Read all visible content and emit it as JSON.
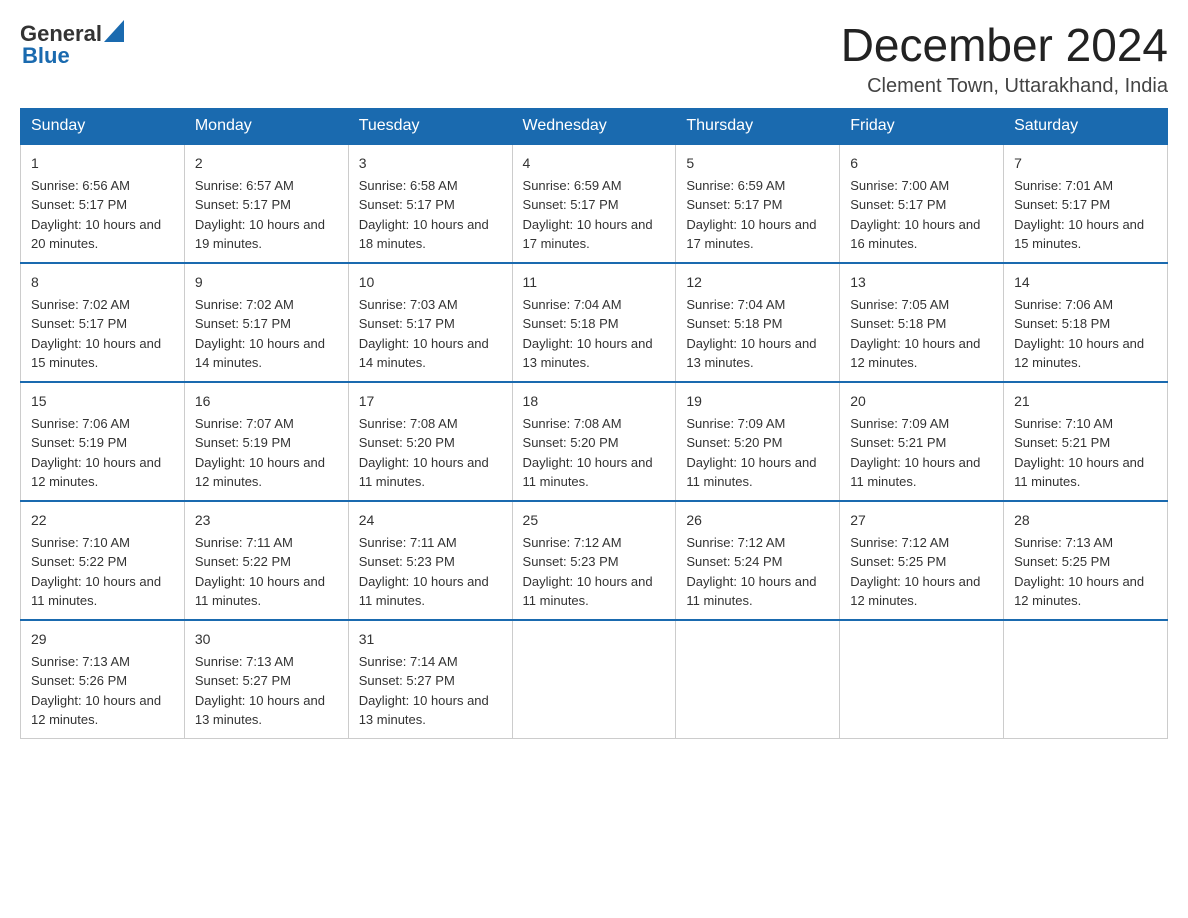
{
  "header": {
    "logo_general": "General",
    "logo_blue": "Blue",
    "title": "December 2024",
    "subtitle": "Clement Town, Uttarakhand, India"
  },
  "days_of_week": [
    "Sunday",
    "Monday",
    "Tuesday",
    "Wednesday",
    "Thursday",
    "Friday",
    "Saturday"
  ],
  "weeks": [
    [
      {
        "day": "1",
        "sunrise": "6:56 AM",
        "sunset": "5:17 PM",
        "daylight": "10 hours and 20 minutes."
      },
      {
        "day": "2",
        "sunrise": "6:57 AM",
        "sunset": "5:17 PM",
        "daylight": "10 hours and 19 minutes."
      },
      {
        "day": "3",
        "sunrise": "6:58 AM",
        "sunset": "5:17 PM",
        "daylight": "10 hours and 18 minutes."
      },
      {
        "day": "4",
        "sunrise": "6:59 AM",
        "sunset": "5:17 PM",
        "daylight": "10 hours and 17 minutes."
      },
      {
        "day": "5",
        "sunrise": "6:59 AM",
        "sunset": "5:17 PM",
        "daylight": "10 hours and 17 minutes."
      },
      {
        "day": "6",
        "sunrise": "7:00 AM",
        "sunset": "5:17 PM",
        "daylight": "10 hours and 16 minutes."
      },
      {
        "day": "7",
        "sunrise": "7:01 AM",
        "sunset": "5:17 PM",
        "daylight": "10 hours and 15 minutes."
      }
    ],
    [
      {
        "day": "8",
        "sunrise": "7:02 AM",
        "sunset": "5:17 PM",
        "daylight": "10 hours and 15 minutes."
      },
      {
        "day": "9",
        "sunrise": "7:02 AM",
        "sunset": "5:17 PM",
        "daylight": "10 hours and 14 minutes."
      },
      {
        "day": "10",
        "sunrise": "7:03 AM",
        "sunset": "5:17 PM",
        "daylight": "10 hours and 14 minutes."
      },
      {
        "day": "11",
        "sunrise": "7:04 AM",
        "sunset": "5:18 PM",
        "daylight": "10 hours and 13 minutes."
      },
      {
        "day": "12",
        "sunrise": "7:04 AM",
        "sunset": "5:18 PM",
        "daylight": "10 hours and 13 minutes."
      },
      {
        "day": "13",
        "sunrise": "7:05 AM",
        "sunset": "5:18 PM",
        "daylight": "10 hours and 12 minutes."
      },
      {
        "day": "14",
        "sunrise": "7:06 AM",
        "sunset": "5:18 PM",
        "daylight": "10 hours and 12 minutes."
      }
    ],
    [
      {
        "day": "15",
        "sunrise": "7:06 AM",
        "sunset": "5:19 PM",
        "daylight": "10 hours and 12 minutes."
      },
      {
        "day": "16",
        "sunrise": "7:07 AM",
        "sunset": "5:19 PM",
        "daylight": "10 hours and 12 minutes."
      },
      {
        "day": "17",
        "sunrise": "7:08 AM",
        "sunset": "5:20 PM",
        "daylight": "10 hours and 11 minutes."
      },
      {
        "day": "18",
        "sunrise": "7:08 AM",
        "sunset": "5:20 PM",
        "daylight": "10 hours and 11 minutes."
      },
      {
        "day": "19",
        "sunrise": "7:09 AM",
        "sunset": "5:20 PM",
        "daylight": "10 hours and 11 minutes."
      },
      {
        "day": "20",
        "sunrise": "7:09 AM",
        "sunset": "5:21 PM",
        "daylight": "10 hours and 11 minutes."
      },
      {
        "day": "21",
        "sunrise": "7:10 AM",
        "sunset": "5:21 PM",
        "daylight": "10 hours and 11 minutes."
      }
    ],
    [
      {
        "day": "22",
        "sunrise": "7:10 AM",
        "sunset": "5:22 PM",
        "daylight": "10 hours and 11 minutes."
      },
      {
        "day": "23",
        "sunrise": "7:11 AM",
        "sunset": "5:22 PM",
        "daylight": "10 hours and 11 minutes."
      },
      {
        "day": "24",
        "sunrise": "7:11 AM",
        "sunset": "5:23 PM",
        "daylight": "10 hours and 11 minutes."
      },
      {
        "day": "25",
        "sunrise": "7:12 AM",
        "sunset": "5:23 PM",
        "daylight": "10 hours and 11 minutes."
      },
      {
        "day": "26",
        "sunrise": "7:12 AM",
        "sunset": "5:24 PM",
        "daylight": "10 hours and 11 minutes."
      },
      {
        "day": "27",
        "sunrise": "7:12 AM",
        "sunset": "5:25 PM",
        "daylight": "10 hours and 12 minutes."
      },
      {
        "day": "28",
        "sunrise": "7:13 AM",
        "sunset": "5:25 PM",
        "daylight": "10 hours and 12 minutes."
      }
    ],
    [
      {
        "day": "29",
        "sunrise": "7:13 AM",
        "sunset": "5:26 PM",
        "daylight": "10 hours and 12 minutes."
      },
      {
        "day": "30",
        "sunrise": "7:13 AM",
        "sunset": "5:27 PM",
        "daylight": "10 hours and 13 minutes."
      },
      {
        "day": "31",
        "sunrise": "7:14 AM",
        "sunset": "5:27 PM",
        "daylight": "10 hours and 13 minutes."
      },
      null,
      null,
      null,
      null
    ]
  ]
}
